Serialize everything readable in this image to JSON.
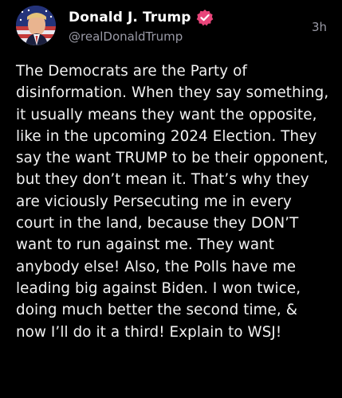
{
  "post": {
    "display_name": "Donald J. Trump",
    "handle": "@realDonaldTrump",
    "timestamp": "3h",
    "verified_badge": "verified-check-icon",
    "text": "The Democrats are the Party of disinformation. When they say something, it usually means they want the opposite, like in the upcoming 2024 Election. They say the want TRUMP to be their opponent, but they don’t mean it. That’s why they are viciously Persecuting me in every court in the land, because they DON’T want to run against me. They want anybody else! Also, the Polls have me leading big against Biden. I won twice, doing much better the second time, & now I’ll do it a third! Explain to WSJ!"
  },
  "colors": {
    "background": "#000000",
    "text": "#f2f2f2",
    "secondary": "#9a9aa6",
    "verified": "#e8457a"
  }
}
